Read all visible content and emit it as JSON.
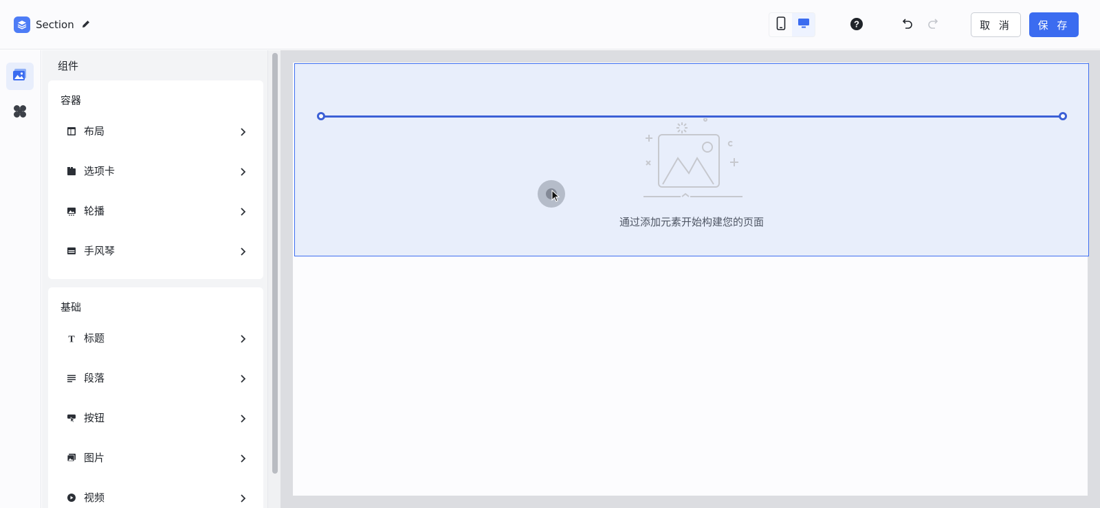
{
  "header": {
    "title": "Section",
    "icons": [
      "layers-logo-icon",
      "pencil-icon",
      "mobile-view-icon",
      "desktop-view-icon",
      "help-icon",
      "undo-icon",
      "redo-icon"
    ],
    "cancel_label": "取 消",
    "save_label": "保 存",
    "active_device": "desktop"
  },
  "rail": {
    "items": [
      {
        "icon": "image-gallery-icon",
        "active": true
      },
      {
        "icon": "clover-icon",
        "active": false
      }
    ]
  },
  "panel": {
    "title": "组件",
    "groups": [
      {
        "title": "容器",
        "items": [
          {
            "label": "布局",
            "icon": "layout-icon"
          },
          {
            "label": "选项卡",
            "icon": "tabs-icon"
          },
          {
            "label": "轮播",
            "icon": "carousel-icon"
          },
          {
            "label": "手风琴",
            "icon": "accordion-icon"
          }
        ]
      },
      {
        "title": "基础",
        "items": [
          {
            "label": "标题",
            "icon": "heading-icon"
          },
          {
            "label": "段落",
            "icon": "paragraph-icon"
          },
          {
            "label": "按钮",
            "icon": "button-icon"
          },
          {
            "label": "图片",
            "icon": "image-icon"
          },
          {
            "label": "视频",
            "icon": "video-icon"
          }
        ]
      }
    ]
  },
  "canvas": {
    "empty_text": "通过添加元素开始构建您的页面"
  },
  "colors": {
    "accent": "#3b6cf0",
    "section_bg": "#e8eefb",
    "canvas_bg": "#dcdde1"
  }
}
